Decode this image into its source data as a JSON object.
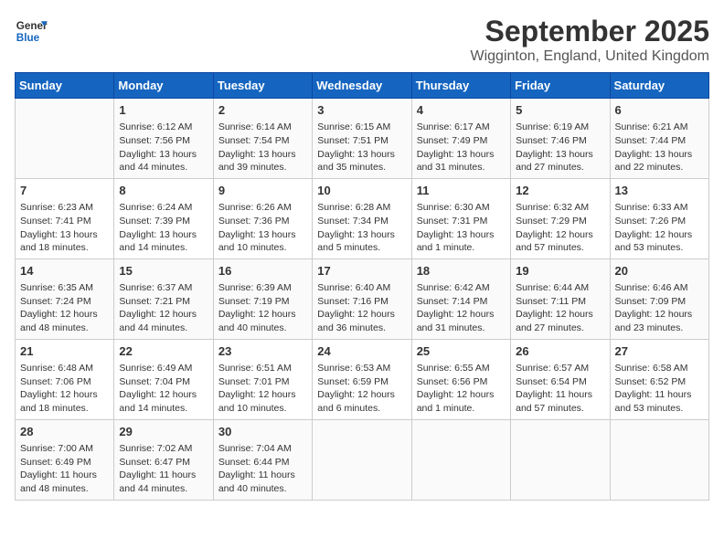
{
  "header": {
    "logo_line1": "General",
    "logo_line2": "Blue",
    "month": "September 2025",
    "location": "Wigginton, England, United Kingdom"
  },
  "weekdays": [
    "Sunday",
    "Monday",
    "Tuesday",
    "Wednesday",
    "Thursday",
    "Friday",
    "Saturday"
  ],
  "weeks": [
    [
      {
        "day": "",
        "info": ""
      },
      {
        "day": "1",
        "info": "Sunrise: 6:12 AM\nSunset: 7:56 PM\nDaylight: 13 hours\nand 44 minutes."
      },
      {
        "day": "2",
        "info": "Sunrise: 6:14 AM\nSunset: 7:54 PM\nDaylight: 13 hours\nand 39 minutes."
      },
      {
        "day": "3",
        "info": "Sunrise: 6:15 AM\nSunset: 7:51 PM\nDaylight: 13 hours\nand 35 minutes."
      },
      {
        "day": "4",
        "info": "Sunrise: 6:17 AM\nSunset: 7:49 PM\nDaylight: 13 hours\nand 31 minutes."
      },
      {
        "day": "5",
        "info": "Sunrise: 6:19 AM\nSunset: 7:46 PM\nDaylight: 13 hours\nand 27 minutes."
      },
      {
        "day": "6",
        "info": "Sunrise: 6:21 AM\nSunset: 7:44 PM\nDaylight: 13 hours\nand 22 minutes."
      }
    ],
    [
      {
        "day": "7",
        "info": "Sunrise: 6:23 AM\nSunset: 7:41 PM\nDaylight: 13 hours\nand 18 minutes."
      },
      {
        "day": "8",
        "info": "Sunrise: 6:24 AM\nSunset: 7:39 PM\nDaylight: 13 hours\nand 14 minutes."
      },
      {
        "day": "9",
        "info": "Sunrise: 6:26 AM\nSunset: 7:36 PM\nDaylight: 13 hours\nand 10 minutes."
      },
      {
        "day": "10",
        "info": "Sunrise: 6:28 AM\nSunset: 7:34 PM\nDaylight: 13 hours\nand 5 minutes."
      },
      {
        "day": "11",
        "info": "Sunrise: 6:30 AM\nSunset: 7:31 PM\nDaylight: 13 hours\nand 1 minute."
      },
      {
        "day": "12",
        "info": "Sunrise: 6:32 AM\nSunset: 7:29 PM\nDaylight: 12 hours\nand 57 minutes."
      },
      {
        "day": "13",
        "info": "Sunrise: 6:33 AM\nSunset: 7:26 PM\nDaylight: 12 hours\nand 53 minutes."
      }
    ],
    [
      {
        "day": "14",
        "info": "Sunrise: 6:35 AM\nSunset: 7:24 PM\nDaylight: 12 hours\nand 48 minutes."
      },
      {
        "day": "15",
        "info": "Sunrise: 6:37 AM\nSunset: 7:21 PM\nDaylight: 12 hours\nand 44 minutes."
      },
      {
        "day": "16",
        "info": "Sunrise: 6:39 AM\nSunset: 7:19 PM\nDaylight: 12 hours\nand 40 minutes."
      },
      {
        "day": "17",
        "info": "Sunrise: 6:40 AM\nSunset: 7:16 PM\nDaylight: 12 hours\nand 36 minutes."
      },
      {
        "day": "18",
        "info": "Sunrise: 6:42 AM\nSunset: 7:14 PM\nDaylight: 12 hours\nand 31 minutes."
      },
      {
        "day": "19",
        "info": "Sunrise: 6:44 AM\nSunset: 7:11 PM\nDaylight: 12 hours\nand 27 minutes."
      },
      {
        "day": "20",
        "info": "Sunrise: 6:46 AM\nSunset: 7:09 PM\nDaylight: 12 hours\nand 23 minutes."
      }
    ],
    [
      {
        "day": "21",
        "info": "Sunrise: 6:48 AM\nSunset: 7:06 PM\nDaylight: 12 hours\nand 18 minutes."
      },
      {
        "day": "22",
        "info": "Sunrise: 6:49 AM\nSunset: 7:04 PM\nDaylight: 12 hours\nand 14 minutes."
      },
      {
        "day": "23",
        "info": "Sunrise: 6:51 AM\nSunset: 7:01 PM\nDaylight: 12 hours\nand 10 minutes."
      },
      {
        "day": "24",
        "info": "Sunrise: 6:53 AM\nSunset: 6:59 PM\nDaylight: 12 hours\nand 6 minutes."
      },
      {
        "day": "25",
        "info": "Sunrise: 6:55 AM\nSunset: 6:56 PM\nDaylight: 12 hours\nand 1 minute."
      },
      {
        "day": "26",
        "info": "Sunrise: 6:57 AM\nSunset: 6:54 PM\nDaylight: 11 hours\nand 57 minutes."
      },
      {
        "day": "27",
        "info": "Sunrise: 6:58 AM\nSunset: 6:52 PM\nDaylight: 11 hours\nand 53 minutes."
      }
    ],
    [
      {
        "day": "28",
        "info": "Sunrise: 7:00 AM\nSunset: 6:49 PM\nDaylight: 11 hours\nand 48 minutes."
      },
      {
        "day": "29",
        "info": "Sunrise: 7:02 AM\nSunset: 6:47 PM\nDaylight: 11 hours\nand 44 minutes."
      },
      {
        "day": "30",
        "info": "Sunrise: 7:04 AM\nSunset: 6:44 PM\nDaylight: 11 hours\nand 40 minutes."
      },
      {
        "day": "",
        "info": ""
      },
      {
        "day": "",
        "info": ""
      },
      {
        "day": "",
        "info": ""
      },
      {
        "day": "",
        "info": ""
      }
    ]
  ]
}
